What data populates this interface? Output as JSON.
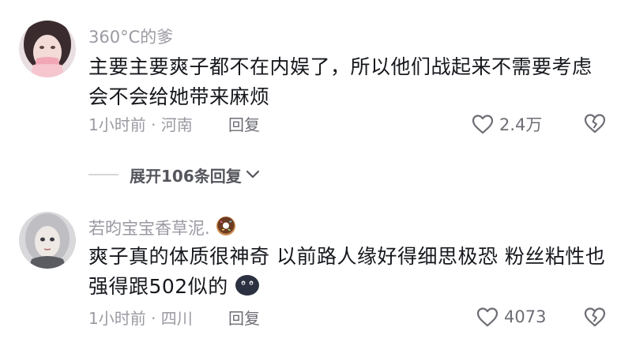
{
  "comments": [
    {
      "username": "360°C的爹",
      "text": "主要主要爽子都不在内娱了，所以他们战起来不需要考虑会不会给她带来麻烦",
      "time_location": "1小时前 · 河南",
      "reply_label": "回复",
      "likes": "2.4万",
      "avatar_icon": "pink-girl-avatar"
    },
    {
      "username": "若昀宝宝香草泥.",
      "text": "爽子真的体质很神奇 以前路人缘好得细思极恐 粉丝粘性也强得跟502似的",
      "time_location": "1小时前 · 四川",
      "reply_label": "回复",
      "likes": "4073",
      "avatar_icon": "doll-avatar",
      "name_emoji": "donut-icon",
      "text_emoji": "dark-round-face-icon"
    }
  ],
  "expand_replies": {
    "label": "展开106条回复"
  },
  "colors": {
    "secondary_text": "#9a9aa2",
    "primary_text": "#16181d",
    "action_text": "#6d6e75"
  }
}
